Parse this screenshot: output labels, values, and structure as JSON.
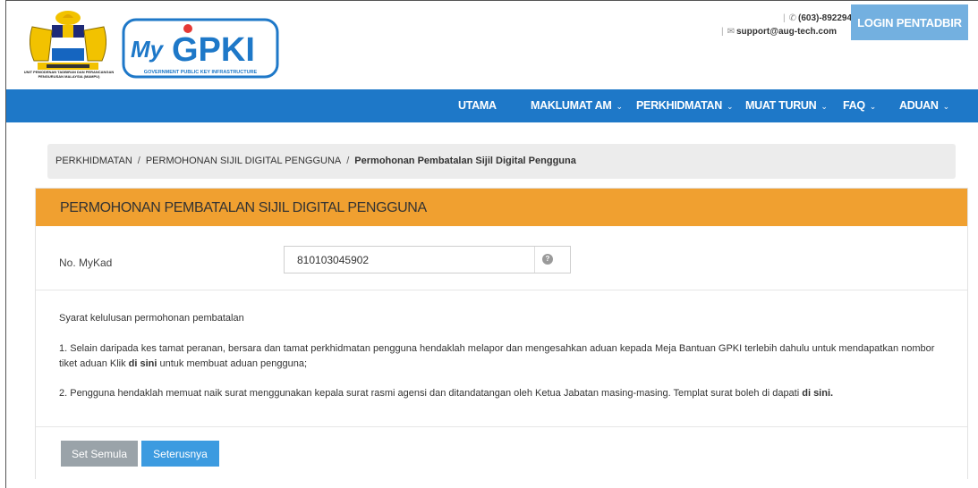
{
  "header": {
    "crest_text": "UNIT PEMODENAN TADBIRAN DAN PERANCANGAN PENGURUSAN MALAYSIA (MAMPU)",
    "logo_text": "MyGPKI",
    "logo_subtitle": "GOVERNMENT PUBLIC KEY INFRASTRUCTURE",
    "phone": "(603)-89229400",
    "email": "support@aug-tech.com",
    "login_label": "LOGIN PENTADBIR"
  },
  "nav": {
    "items": [
      {
        "label": "UTAMA",
        "dropdown": false
      },
      {
        "label": "MAKLUMAT AM",
        "dropdown": true
      },
      {
        "label": "PERKHIDMATAN",
        "dropdown": true
      },
      {
        "label": "MUAT TURUN",
        "dropdown": true
      },
      {
        "label": "FAQ",
        "dropdown": true
      },
      {
        "label": "ADUAN",
        "dropdown": true
      }
    ]
  },
  "breadcrumb": {
    "items": [
      "PERKHIDMATAN",
      "PERMOHONAN SIJIL DIGITAL PENGGUNA"
    ],
    "current": "Permohonan Pembatalan Sijil Digital Pengguna"
  },
  "panel": {
    "title": "PERMOHONAN PEMBATALAN SIJIL DIGITAL PENGGUNA",
    "mykad_label": "No. MyKad",
    "mykad_value": "810103045902"
  },
  "terms": {
    "heading": "Syarat kelulusan permohonan pembatalan",
    "item1_text": "1. Selain daripada kes tamat peranan, bersara dan tamat perkhidmatan pengguna hendaklah melapor dan mengesahkan aduan kepada Meja Bantuan GPKI terlebih dahulu untuk mendapatkan nombor tiket aduan Klik ",
    "item1_link": "di sini",
    "item1_suffix": " untuk membuat aduan pengguna;",
    "item2_text": "2. Pengguna hendaklah memuat naik surat menggunakan kepala surat rasmi agensi dan ditandatangan oleh Ketua Jabatan masing-masing. Templat surat boleh di dapati ",
    "item2_link": "di sini."
  },
  "actions": {
    "reset_label": "Set Semula",
    "next_label": "Seterusnya"
  },
  "colors": {
    "nav_blue": "#1e78c8",
    "panel_orange": "#f0a030",
    "login_blue": "#73b0e0",
    "next_blue": "#3c9be0",
    "reset_grey": "#9aa3a9"
  },
  "icons": {
    "phone": "phone-icon",
    "email": "envelope-icon",
    "help": "question-circle-icon",
    "dropdown": "chevron-down-icon"
  }
}
